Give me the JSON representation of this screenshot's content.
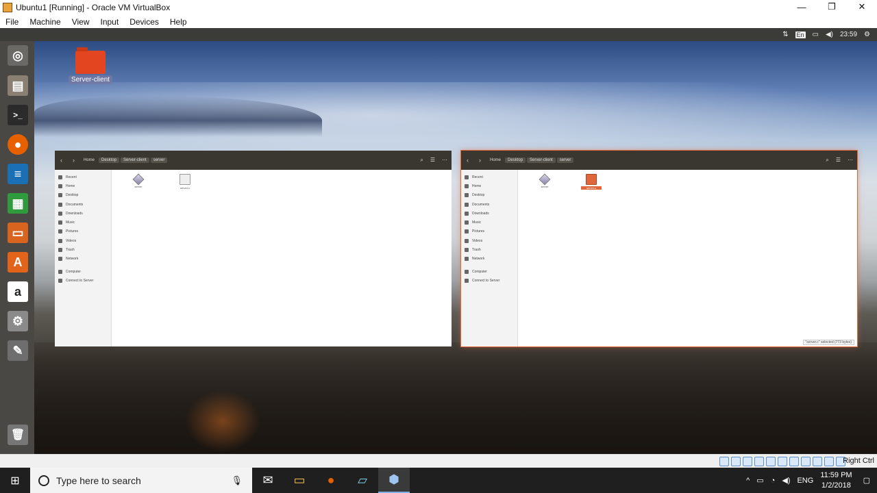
{
  "host_window": {
    "title": "Ubuntu1 [Running] - Oracle VM VirtualBox",
    "controls": {
      "minimize": "—",
      "restore": "❐",
      "close": "✕"
    }
  },
  "menu": [
    "File",
    "Machine",
    "View",
    "Input",
    "Devices",
    "Help"
  ],
  "ubuntu_panel": {
    "network_glyph": "⇅",
    "keyboard_layout": "En",
    "battery_glyph": "▭",
    "volume_glyph": "◀)",
    "time": "23:59",
    "settings_glyph": "⚙"
  },
  "launcher": [
    {
      "name": "dash",
      "glyph": "◎",
      "color": "#6b6966"
    },
    {
      "name": "files",
      "glyph": "▤",
      "color": "#8a7f73"
    },
    {
      "name": "terminal",
      "glyph": ">_",
      "color": "#2b2b2b"
    },
    {
      "name": "firefox",
      "glyph": "●",
      "color": "#e66000"
    },
    {
      "name": "writer",
      "glyph": "≡",
      "color": "#1b6fb5"
    },
    {
      "name": "calc",
      "glyph": "▦",
      "color": "#2f9b3c"
    },
    {
      "name": "impress",
      "glyph": "▭",
      "color": "#d8641f"
    },
    {
      "name": "software",
      "glyph": "A",
      "color": "#e2641a"
    },
    {
      "name": "amazon",
      "glyph": "a",
      "color": "#222222"
    },
    {
      "name": "settings",
      "glyph": "⚙",
      "color": "#8a8a8a"
    },
    {
      "name": "text-editor",
      "glyph": "✎",
      "color": "#6e6e6e"
    }
  ],
  "trash_glyph": "🗑",
  "desktop": {
    "folder_label": "Server-client"
  },
  "windows": [
    {
      "crumbs": [
        "Home",
        "Desktop",
        "Server-client",
        "server"
      ],
      "sidebar": [
        "Recent",
        "Home",
        "Desktop",
        "Documents",
        "Downloads",
        "Music",
        "Pictures",
        "Videos",
        "Trash",
        "Network",
        "Computer",
        "Connect to Server"
      ],
      "files": [
        {
          "type": "diamond",
          "label": "server"
        },
        {
          "type": "doc",
          "label": "server.c"
        }
      ],
      "status": ""
    },
    {
      "crumbs": [
        "Home",
        "Desktop",
        "Server-client",
        "server"
      ],
      "sidebar": [
        "Recent",
        "Home",
        "Desktop",
        "Documents",
        "Downloads",
        "Music",
        "Pictures",
        "Videos",
        "Trash",
        "Network",
        "Computer",
        "Connect to Server"
      ],
      "files": [
        {
          "type": "diamond",
          "label": "server"
        },
        {
          "type": "doc-orange",
          "label": "server.c"
        }
      ],
      "status": "\"server.c\" selected (773 bytes)"
    }
  ],
  "vb_status": {
    "host_key": "Right Ctrl"
  },
  "taskbar": {
    "search_placeholder": "Type here to search",
    "apps": [
      {
        "name": "mail",
        "glyph": "✉"
      },
      {
        "name": "file-explorer",
        "glyph": "▭"
      },
      {
        "name": "firefox",
        "glyph": "●"
      },
      {
        "name": "notes",
        "glyph": "▱"
      },
      {
        "name": "virtualbox",
        "glyph": "⬢"
      }
    ],
    "tray": {
      "chevron": "^",
      "lang": "ENG",
      "time": "11:59 PM",
      "date": "1/2/2018"
    }
  }
}
